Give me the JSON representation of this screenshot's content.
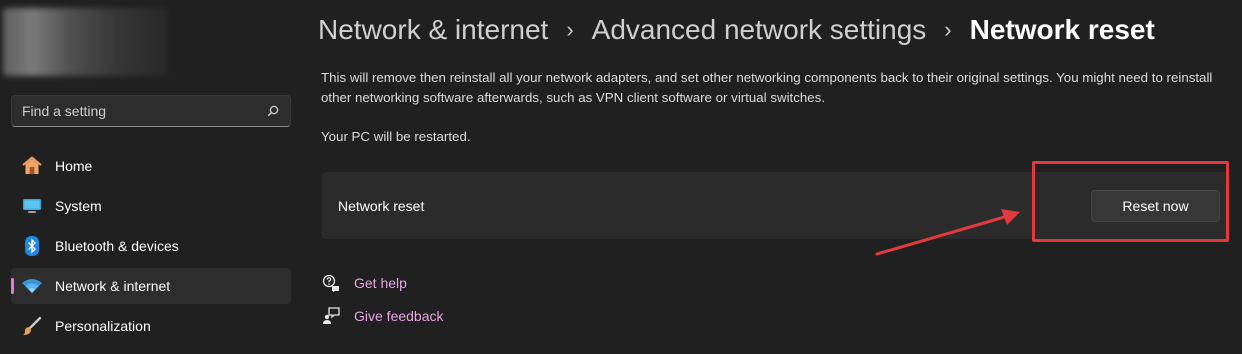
{
  "sidebar": {
    "search_placeholder": "Find a setting",
    "items": [
      {
        "label": "Home",
        "icon": "home-icon"
      },
      {
        "label": "System",
        "icon": "system-icon"
      },
      {
        "label": "Bluetooth & devices",
        "icon": "bluetooth-icon"
      },
      {
        "label": "Network & internet",
        "icon": "wifi-icon",
        "active": true
      },
      {
        "label": "Personalization",
        "icon": "brush-icon"
      }
    ]
  },
  "breadcrumb": {
    "items": [
      "Network & internet",
      "Advanced network settings",
      "Network reset"
    ],
    "separator": "›"
  },
  "main": {
    "description": "This will remove then reinstall all your network adapters, and set other networking components back to their original settings. You might need to reinstall other networking software afterwards, such as VPN client software or virtual switches.",
    "restart_note": "Your PC will be restarted.",
    "card_label": "Network reset",
    "reset_button_label": "Reset now"
  },
  "links": {
    "get_help": "Get help",
    "give_feedback": "Give feedback"
  },
  "colors": {
    "accent": "#e37bd6",
    "link": "#e8a5e3",
    "annotation": "#e03a3e",
    "background": "#202020"
  }
}
